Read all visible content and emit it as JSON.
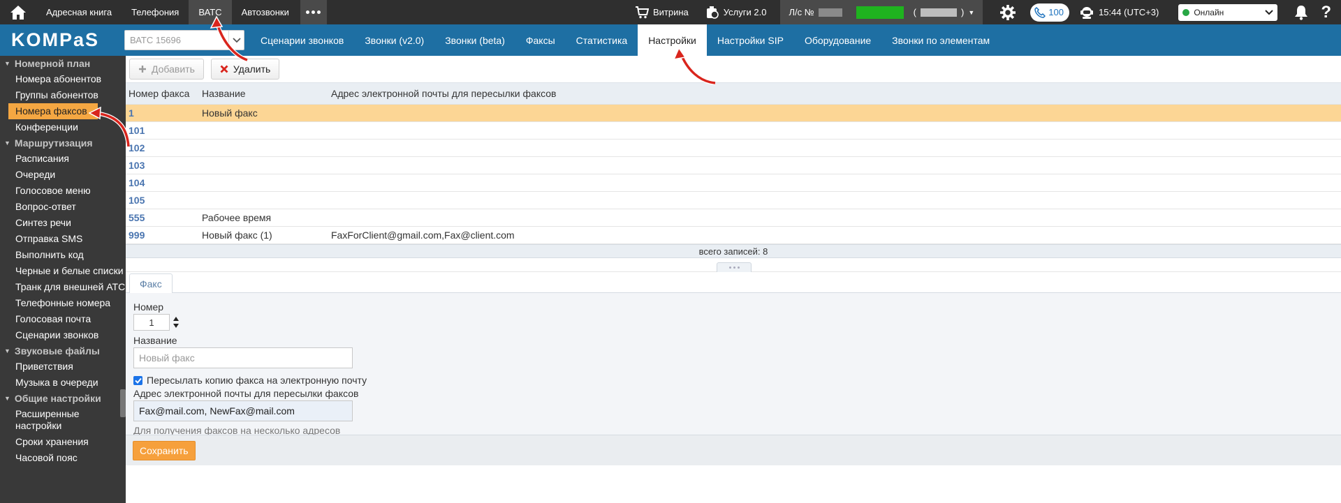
{
  "topbar": {
    "nav": [
      "Адресная книга",
      "Телефония",
      "ВАТС",
      "Автозвонки"
    ],
    "active_nav": "ВАТС",
    "showcase": "Витрина",
    "services": "Услуги 2.0",
    "account_prefix": "Л/с №",
    "calls_count": "100",
    "time": "15:44 (UTC+3)",
    "status": "Онлайн"
  },
  "header": {
    "logo": "KOMPaS",
    "pbx_select": "ВАТС 15696",
    "tabs": [
      "Сценарии звонков",
      "Звонки (v2.0)",
      "Звонки (beta)",
      "Факсы",
      "Статистика",
      "Настройки",
      "Настройки SIP",
      "Оборудование",
      "Звонки по элементам"
    ],
    "active_tab": "Настройки"
  },
  "sidebar": {
    "sections": [
      {
        "title": "Номерной план",
        "items": [
          "Номера абонентов",
          "Группы абонентов",
          "Номера факсов",
          "Конференции"
        ]
      },
      {
        "title": "Маршрутизация",
        "items": [
          "Расписания",
          "Очереди",
          "Голосовое меню",
          "Вопрос-ответ",
          "Синтез речи",
          "Отправка SMS",
          "Выполнить код",
          "Черные и белые списки",
          "Транк для внешней АТС",
          "Телефонные номера",
          "Голосовая почта",
          "Сценарии звонков"
        ]
      },
      {
        "title": "Звуковые файлы",
        "items": [
          "Приветствия",
          "Музыка в очереди"
        ]
      },
      {
        "title": "Общие настройки",
        "items": [
          "Расширенные настройки",
          "Сроки хранения",
          "Часовой пояс"
        ]
      }
    ],
    "active_item": "Номера факсов"
  },
  "toolbar": {
    "add_label": "Добавить",
    "delete_label": "Удалить"
  },
  "grid": {
    "columns": [
      "Номер факса",
      "Название",
      "Адрес электронной почты для пересылки факсов"
    ],
    "rows": [
      {
        "number": "1",
        "name": "Новый факс",
        "email": ""
      },
      {
        "number": "101",
        "name": "",
        "email": ""
      },
      {
        "number": "102",
        "name": "",
        "email": ""
      },
      {
        "number": "103",
        "name": "",
        "email": ""
      },
      {
        "number": "104",
        "name": "",
        "email": ""
      },
      {
        "number": "105",
        "name": "",
        "email": ""
      },
      {
        "number": "555",
        "name": "Рабочее время",
        "email": ""
      },
      {
        "number": "999",
        "name": "Новый факс (1)",
        "email": "FaxForClient@gmail.com,Fax@client.com"
      }
    ],
    "selected_row": "1",
    "footer": "всего записей: 8"
  },
  "form": {
    "tab": "Факс",
    "number_label": "Номер",
    "number_value": "1",
    "name_label": "Название",
    "name_placeholder": "Новый факс",
    "forward_checkbox_label": "Пересылать копию факса на электронную почту",
    "forward_checked": true,
    "email_label": "Адрес электронной почты для пересылки факсов",
    "email_value": "Fax@mail.com, NewFax@mail.com",
    "hint": "Для получения факсов на несколько адресов электронной почты укажите их через запятую",
    "save_label": "Сохранить"
  },
  "colors": {
    "topbar_bg": "#2f2f2f",
    "header_bg": "#1e6fa3",
    "sidebar_bg": "#393939",
    "highlight": "#f5a742",
    "selected_row": "#fcd695",
    "save_button": "#f6a03c",
    "annotation_arrow": "#d9251d"
  }
}
